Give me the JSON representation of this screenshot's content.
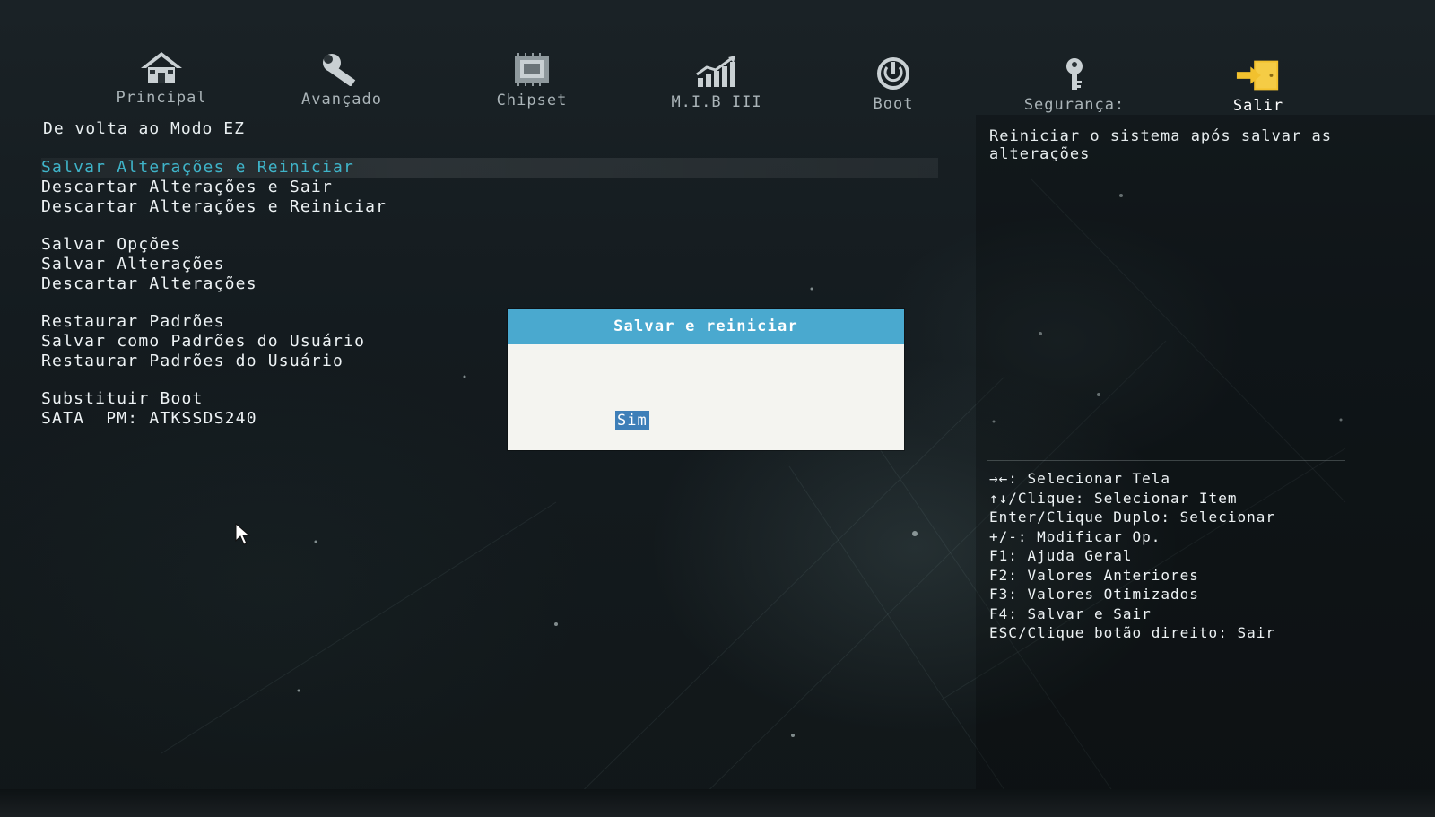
{
  "tabs": [
    {
      "label": "Principal",
      "icon": "home-icon",
      "active": false
    },
    {
      "label": "Avançado",
      "icon": "wrench-icon",
      "active": false
    },
    {
      "label": "Chipset",
      "icon": "chip-icon",
      "active": false
    },
    {
      "label": "M.I.B III",
      "icon": "chart-icon",
      "active": false
    },
    {
      "label": "Boot",
      "icon": "power-icon",
      "active": false
    },
    {
      "label": "Segurança:",
      "icon": "key-icon",
      "active": false
    },
    {
      "label": "Salir",
      "icon": "exit-icon",
      "active": true
    }
  ],
  "menu": {
    "title": "De volta ao Modo EZ",
    "groups": [
      [
        "Salvar Alterações e Reiniciar",
        "Descartar Alterações e Sair",
        "Descartar Alterações e Reiniciar"
      ],
      [
        "Salvar Opções",
        "Salvar Alterações",
        "Descartar Alterações"
      ],
      [
        "Restaurar Padrões",
        "Salvar como Padrões do Usuário",
        "Restaurar Padrões do Usuário"
      ],
      [
        "Substituir Boot",
        "SATA  PM: ATKSSDS240"
      ]
    ],
    "selected": "Salvar Alterações e Reiniciar"
  },
  "help": {
    "text": "Reiniciar o sistema após salvar as alterações"
  },
  "keys": [
    "→←: Selecionar Tela",
    "↑↓/Clique: Selecionar Item",
    "Enter/Clique Duplo: Selecionar",
    "+/-: Modificar Op.",
    "F1: Ajuda Geral",
    "F2: Valores Anteriores",
    "F3: Valores Otimizados",
    "F4: Salvar e Sair",
    "ESC/Clique botão direito: Sair"
  ],
  "dialog": {
    "title": "Salvar e reiniciar",
    "option": "Sim"
  },
  "colors": {
    "selected_text": "#3fb4c9",
    "dialog_header": "#4aa9cf",
    "active_tab_icon": "#f2c12e"
  }
}
